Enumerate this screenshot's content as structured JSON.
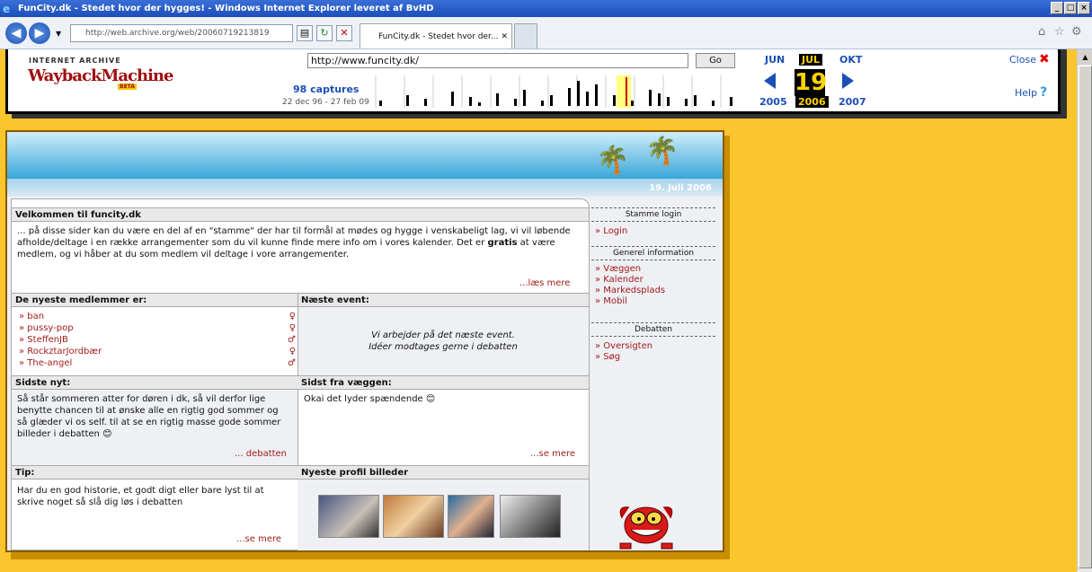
{
  "browser": {
    "window_title": "FunCity.dk - Stedet hvor der hygges! - Windows Internet Explorer leveret af BvHD",
    "address": "http://web.archive.org/web/20060719213819",
    "tab_title": "FunCity.dk - Stedet hvor der...",
    "tab_close": "✕"
  },
  "wayback": {
    "ia_text": "INTERNET ARCHIVE",
    "logo": "WaybackMachine",
    "beta": "BETA",
    "url": "http://www.funcity.dk/",
    "go": "Go",
    "captures": "98 captures",
    "capture_range": "22 dec 96 - 27 feb 09",
    "months": [
      "JUN",
      "JUL",
      "OKT"
    ],
    "day": "19",
    "years": [
      "2005",
      "2006",
      "2007"
    ],
    "close": "Close",
    "help": "Help"
  },
  "site": {
    "date": "19. juli 2006",
    "welcome_title": "Velkommen til funcity.dk",
    "welcome_text_1": "... på disse sider kan du være en del af en \"stamme\" der har til formål at mødes og hygge i venskabeligt lag, vi vil løbende afholde/deltage i en række arrangementer som du vil kunne finde mere info om i vores kalender. Det er ",
    "welcome_bold": "gratis",
    "welcome_text_2": " at være medlem, og vi håber at du som medlem vil deltage i vore arrangementer.",
    "read_more": "...læs mere",
    "members_title": "De nyeste medlemmer er:",
    "members": [
      {
        "name": "» ban",
        "gender": "♀"
      },
      {
        "name": "» pussy-pop",
        "gender": "♀"
      },
      {
        "name": "» SteffenJB",
        "gender": "♂"
      },
      {
        "name": "» RockztarJordbær",
        "gender": "♀"
      },
      {
        "name": "» The-angel",
        "gender": "♂"
      }
    ],
    "event_title": "Næste event:",
    "event_line1": "Vi arbejder på det næste event.",
    "event_line2": "Idéer modtages gerne i debatten",
    "news_title": "Sidste nyt:",
    "news_text": "Så står sommeren atter for døren i dk, så vil derfor lige benytte chancen til at ønske alle en rigtig god sommer og så glæder vi os self. til at se en rigtig masse gode sommer billeder i debatten",
    "news_more": "... debatten",
    "wall_title": "Sidst fra væggen:",
    "wall_text": "Okai det lyder spændende",
    "wall_more": "...se mere",
    "tip_title": "Tip:",
    "tip_text": "Har du en god historie, et godt digt eller bare lyst til at skrive noget så slå dig løs i debatten",
    "tip_more": "...se mere",
    "profiles_title": "Nyeste profil billeder"
  },
  "sidebar": {
    "login_title": "Stamme login",
    "login": "» Login",
    "info_title": "Generel information",
    "info_links": [
      "» Væggen",
      "» Kalender",
      "» Markedsplads",
      "» Mobil"
    ],
    "debate_title": "Debatten",
    "debate_links": [
      "» Oversigten",
      "» Søg"
    ]
  }
}
